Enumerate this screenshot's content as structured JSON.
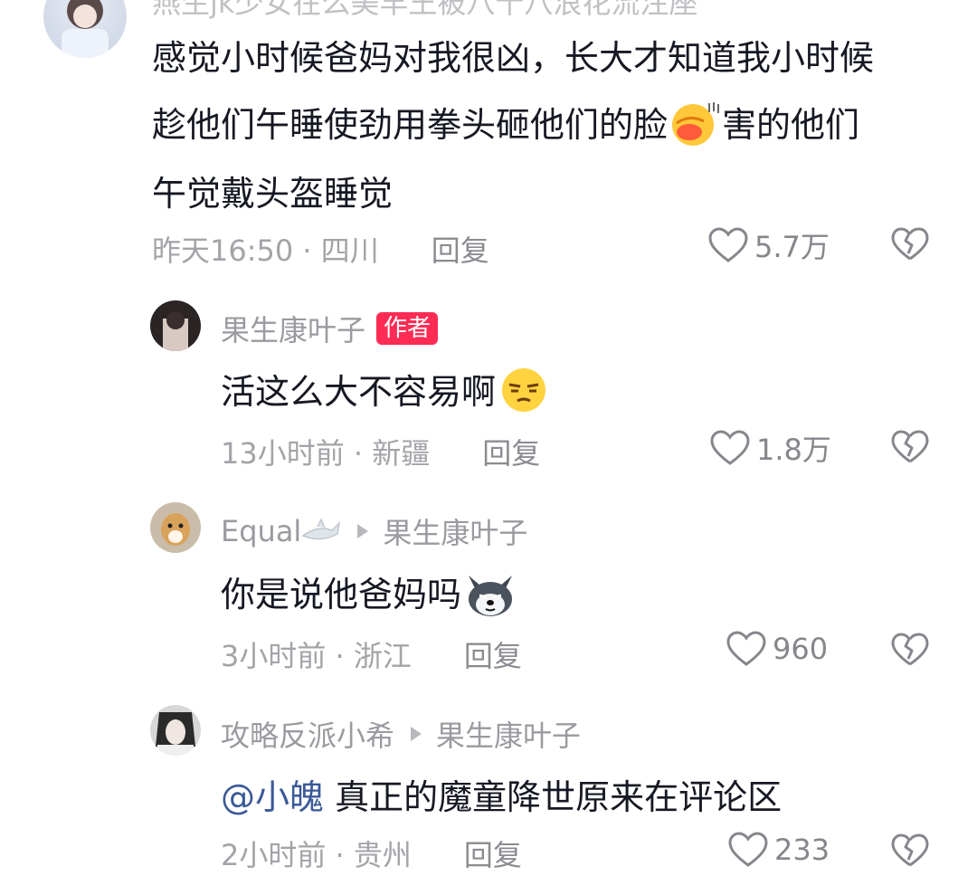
{
  "comments": [
    {
      "name": "燕生jk少女在么美羊王被八十八浪花流注座",
      "line1": "感觉小时候爸妈对我很凶，长大才知道我小时候",
      "line2a": "趁他们午睡使劲用拳头砸他们的脸",
      "line2b": "害的他们",
      "line3": "午觉戴头盔睡觉",
      "meta": "昨天16:50 · 四川",
      "reply": "回复",
      "likes": "5.7万"
    },
    {
      "name": "果生康叶子",
      "badge": "作者",
      "text": "活这么大不容易啊",
      "meta": "13小时前 · 新疆",
      "reply": "回复",
      "likes": "1.8万"
    },
    {
      "name": "Equal",
      "reply_to": "果生康叶子",
      "text": "你是说他爸妈吗",
      "meta": "3小时前 · 浙江",
      "reply": "回复",
      "likes": "960"
    },
    {
      "name": "攻略反派小希",
      "reply_to": "果生康叶子",
      "mention": "@小魄",
      "text": "真正的魔童降世原来在评论区",
      "meta": "2小时前 · 贵州",
      "reply": "回复",
      "likes": "233"
    }
  ],
  "icons": {
    "like": "heart-outline-icon",
    "dislike": "broken-heart-icon",
    "reply_arrow": "play-triangle-icon"
  },
  "colors": {
    "author_badge": "#fe2c55",
    "mention": "#3b5998",
    "meta": "#a3a4a8"
  }
}
